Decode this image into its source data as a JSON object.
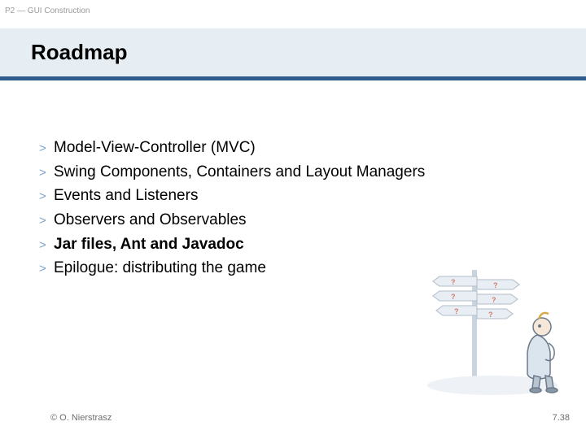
{
  "breadcrumb": "P2 — GUI Construction",
  "title": "Roadmap",
  "items": [
    {
      "text": "Model-View-Controller (MVC)",
      "bold": false
    },
    {
      "text": "Swing Components, Containers and Layout Managers",
      "bold": false
    },
    {
      "text": "Events and Listeners",
      "bold": false
    },
    {
      "text": "Observers and Observables",
      "bold": false
    },
    {
      "text": "Jar files, Ant and Javadoc",
      "bold": true
    },
    {
      "text": "Epilogue: distributing the game",
      "bold": false
    }
  ],
  "bullet": ">",
  "footer_left": "© O. Nierstrasz",
  "footer_right": "7.38"
}
